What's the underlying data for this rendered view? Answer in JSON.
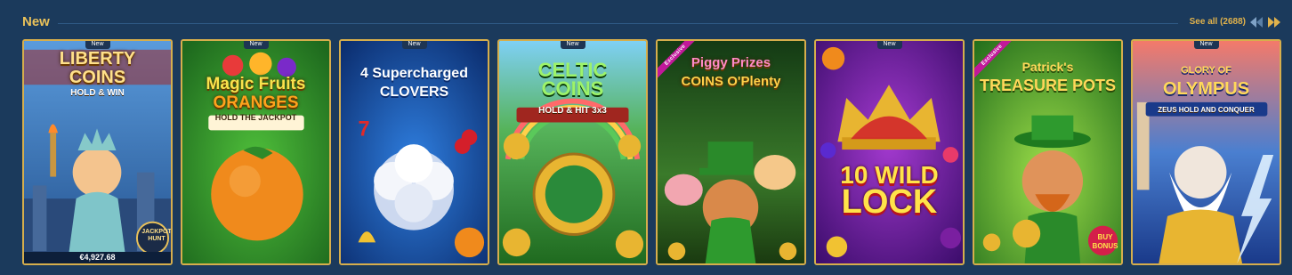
{
  "section": {
    "title": "New",
    "see_all_label": "See all (2688)",
    "prev_icon": "chevron-left-double-icon",
    "next_icon": "chevron-right-double-icon"
  },
  "games": [
    {
      "name": "Liberty Coins",
      "title_line1": "LIBERTY",
      "title_line2": "COINS",
      "subtitle": "HOLD & WIN",
      "badge": "New",
      "jackpot": "€4,927.68",
      "icon_label": "JACKPOT HUNT",
      "bg": "#3f7fc9"
    },
    {
      "name": "Magic Fruits Oranges",
      "title_line1": "Magic Fruits",
      "title_line2": "ORANGES",
      "subtitle": "HOLD THE JACKPOT",
      "badge": "New",
      "bg": "#2e8a2a"
    },
    {
      "name": "4 Supercharged Clovers",
      "title_line1": "4 Supercharged",
      "title_line2": "CLOVERS",
      "subtitle": "",
      "badge": "New",
      "bg": "#1f4fae"
    },
    {
      "name": "Celtic Coins",
      "title_line1": "CELTIC",
      "title_line2": "COINS",
      "subtitle": "HOLD & HIT 3x3",
      "badge": "New",
      "bg": "#3aa83a"
    },
    {
      "name": "Piggy Prizes Coins O'Plenty",
      "title_line1": "Piggy Prizes",
      "title_line2": "COINS O'Plenty",
      "subtitle": "",
      "badge": "Exclusive",
      "bg": "#2a6b2a"
    },
    {
      "name": "10 Wild Lock",
      "title_line1": "10 WILD",
      "title_line2": "LOCK",
      "subtitle": "",
      "badge": "New",
      "bg": "#6a1fa0"
    },
    {
      "name": "Patrick's Treasure Pots",
      "title_line1": "Patrick's",
      "title_line2": "TREASURE POTS",
      "subtitle": "BUY BONUS",
      "badge": "Exclusive",
      "bg": "#3a9a2a"
    },
    {
      "name": "Glory of Olympus",
      "title_line1": "GLORY OF",
      "title_line2": "OLYMPUS",
      "subtitle": "ZEUS HOLD AND CONQUER",
      "badge": "New",
      "bg": "#3b6fc0"
    }
  ]
}
